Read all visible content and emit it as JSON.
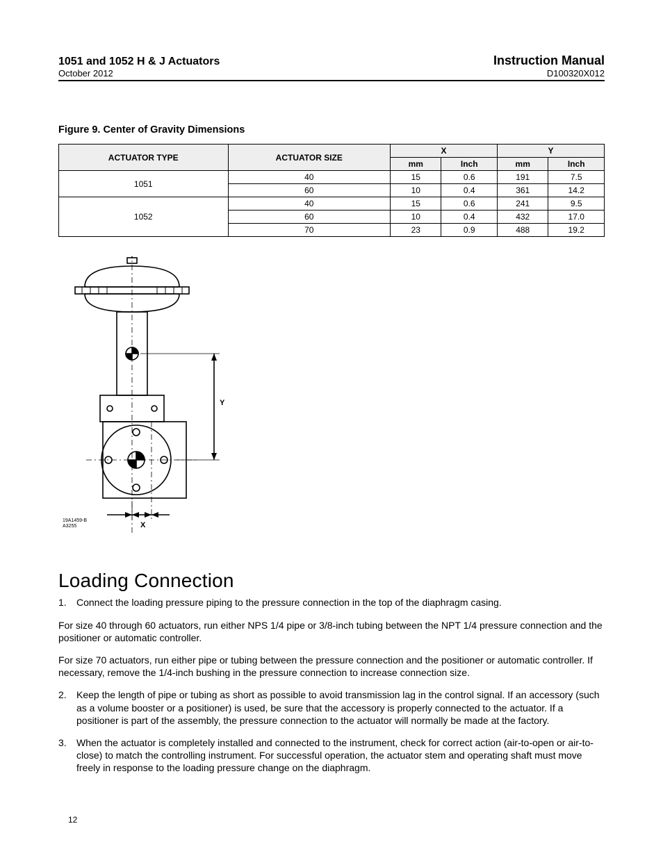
{
  "header": {
    "left_title": "1051 and 1052 H & J Actuators",
    "left_date": "October 2012",
    "right_title": "Instruction Manual",
    "right_doc": "D100320X012"
  },
  "figure": {
    "caption": "Figure 9. Center of Gravity Dimensions",
    "drawing_ref1": "19A1459-B",
    "drawing_ref2": "A3255",
    "label_x": "X",
    "label_y": "Y"
  },
  "table": {
    "col_actuator_type": "ACTUATOR TYPE",
    "col_actuator_size": "ACTUATOR SIZE",
    "col_x": "X",
    "col_y": "Y",
    "col_mm": "mm",
    "col_inch": "Inch",
    "rows": [
      {
        "type": "1051",
        "size": "40",
        "x_mm": "15",
        "x_in": "0.6",
        "y_mm": "191",
        "y_in": "7.5"
      },
      {
        "type": "",
        "size": "60",
        "x_mm": "10",
        "x_in": "0.4",
        "y_mm": "361",
        "y_in": "14.2"
      },
      {
        "type": "1052",
        "size": "40",
        "x_mm": "15",
        "x_in": "0.6",
        "y_mm": "241",
        "y_in": "9.5"
      },
      {
        "type": "",
        "size": "60",
        "x_mm": "10",
        "x_in": "0.4",
        "y_mm": "432",
        "y_in": "17.0"
      },
      {
        "type": "",
        "size": "70",
        "x_mm": "23",
        "x_in": "0.9",
        "y_mm": "488",
        "y_in": "19.2"
      }
    ]
  },
  "section": {
    "heading": "Loading Connection",
    "item1": "Connect the loading pressure piping to the pressure connection in the top of the diaphragm casing.",
    "para_a": "For size 40 through 60 actuators, run either NPS 1/4 pipe or 3/8-inch tubing between the NPT 1/4 pressure connection and the positioner or automatic controller.",
    "para_b": "For size 70 actuators, run either pipe or tubing between the pressure connection and the positioner or automatic controller. If necessary, remove the 1/4-inch bushing in the pressure connection to increase connection size.",
    "item2": "Keep the length of pipe or tubing as short as possible to avoid transmission lag in the control signal. If an accessory (such as a volume booster or a positioner) is used, be sure that the accessory is properly connected to the actuator. If a positioner is part of the assembly, the pressure connection to the actuator will normally be made at the factory.",
    "item3": "When the actuator is completely installed and connected to the instrument, check for correct action (air-to-open or air-to-close) to match the controlling instrument. For successful operation, the actuator stem and operating shaft must move freely in response to the loading pressure change on the diaphragm."
  },
  "page_number": "12"
}
